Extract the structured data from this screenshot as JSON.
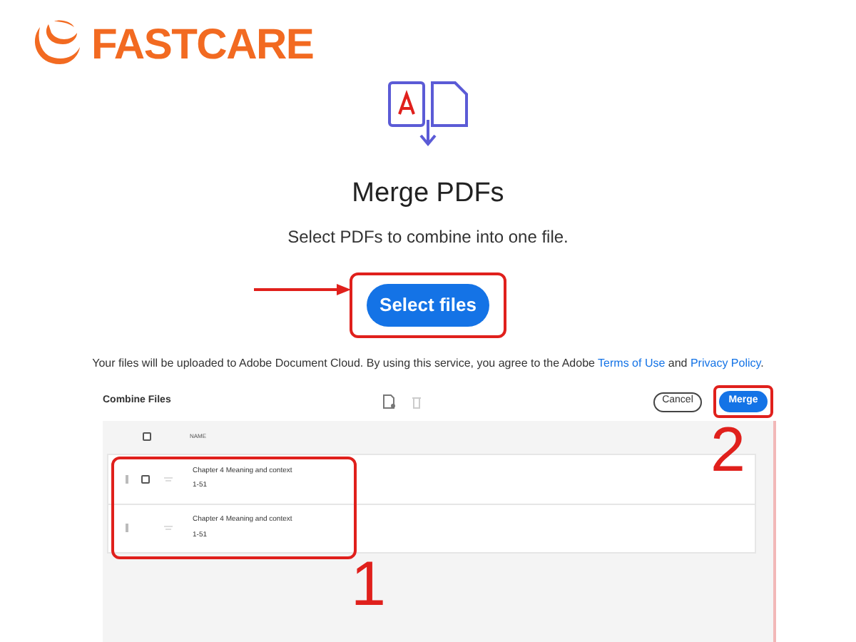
{
  "brand": {
    "name": "FASTCARE"
  },
  "hero": {
    "title": "Merge PDFs",
    "subtitle": "Select PDFs to combine into one file.",
    "button": "Select files"
  },
  "notice": {
    "text": "Your files will be uploaded to Adobe Document Cloud.  By using this service, you agree to the Adobe",
    "links": [
      "Terms of Use",
      "Privacy Policy"
    ],
    "joiner": "and",
    "end": "."
  },
  "panel": {
    "title": "Combine Files",
    "cancel": "Cancel",
    "merge": "Merge",
    "column": "NAME",
    "select_all_checked": false,
    "rows": [
      {
        "name": "Chapter 4 Meaning and context",
        "pages": "1-51",
        "checkable": true
      },
      {
        "name": "Chapter 4 Meaning and context",
        "pages": "1-51",
        "checkable": false
      }
    ]
  },
  "annotations": [
    {
      "label": "1"
    },
    {
      "label": "2"
    }
  ]
}
